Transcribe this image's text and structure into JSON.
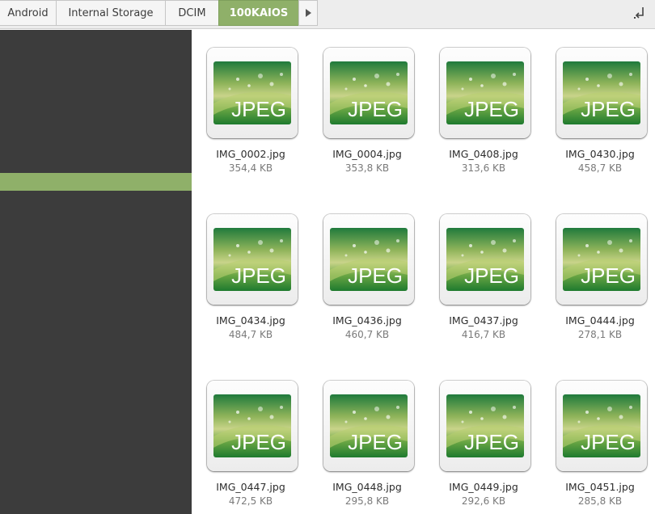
{
  "pathbar": {
    "crumbs": [
      {
        "label": "Android"
      },
      {
        "label": "Internal Storage"
      },
      {
        "label": "DCIM"
      },
      {
        "label": "100KAIOS"
      }
    ],
    "forward_icon": "triangle-right-icon",
    "toggle_icon": "path-toggle-icon",
    "accent_color": "#8fb069"
  },
  "sidebar": {
    "background": "#3c3c3c",
    "selected_color": "#8fb069"
  },
  "files": [
    {
      "name": "IMG_0002.jpg",
      "size": "354,4 KB",
      "badge": "JPEG"
    },
    {
      "name": "IMG_0004.jpg",
      "size": "353,8 KB",
      "badge": "JPEG"
    },
    {
      "name": "IMG_0408.jpg",
      "size": "313,6 KB",
      "badge": "JPEG"
    },
    {
      "name": "IMG_0430.jpg",
      "size": "458,7 KB",
      "badge": "JPEG"
    },
    {
      "name": "IMG_0434.jpg",
      "size": "484,7 KB",
      "badge": "JPEG"
    },
    {
      "name": "IMG_0436.jpg",
      "size": "460,7 KB",
      "badge": "JPEG"
    },
    {
      "name": "IMG_0437.jpg",
      "size": "416,7 KB",
      "badge": "JPEG"
    },
    {
      "name": "IMG_0444.jpg",
      "size": "278,1 KB",
      "badge": "JPEG"
    },
    {
      "name": "IMG_0447.jpg",
      "size": "472,5 KB",
      "badge": "JPEG"
    },
    {
      "name": "IMG_0448.jpg",
      "size": "295,8 KB",
      "badge": "JPEG"
    },
    {
      "name": "IMG_0449.jpg",
      "size": "292,6 KB",
      "badge": "JPEG"
    },
    {
      "name": "IMG_0451.jpg",
      "size": "285,8 KB",
      "badge": "JPEG"
    }
  ]
}
